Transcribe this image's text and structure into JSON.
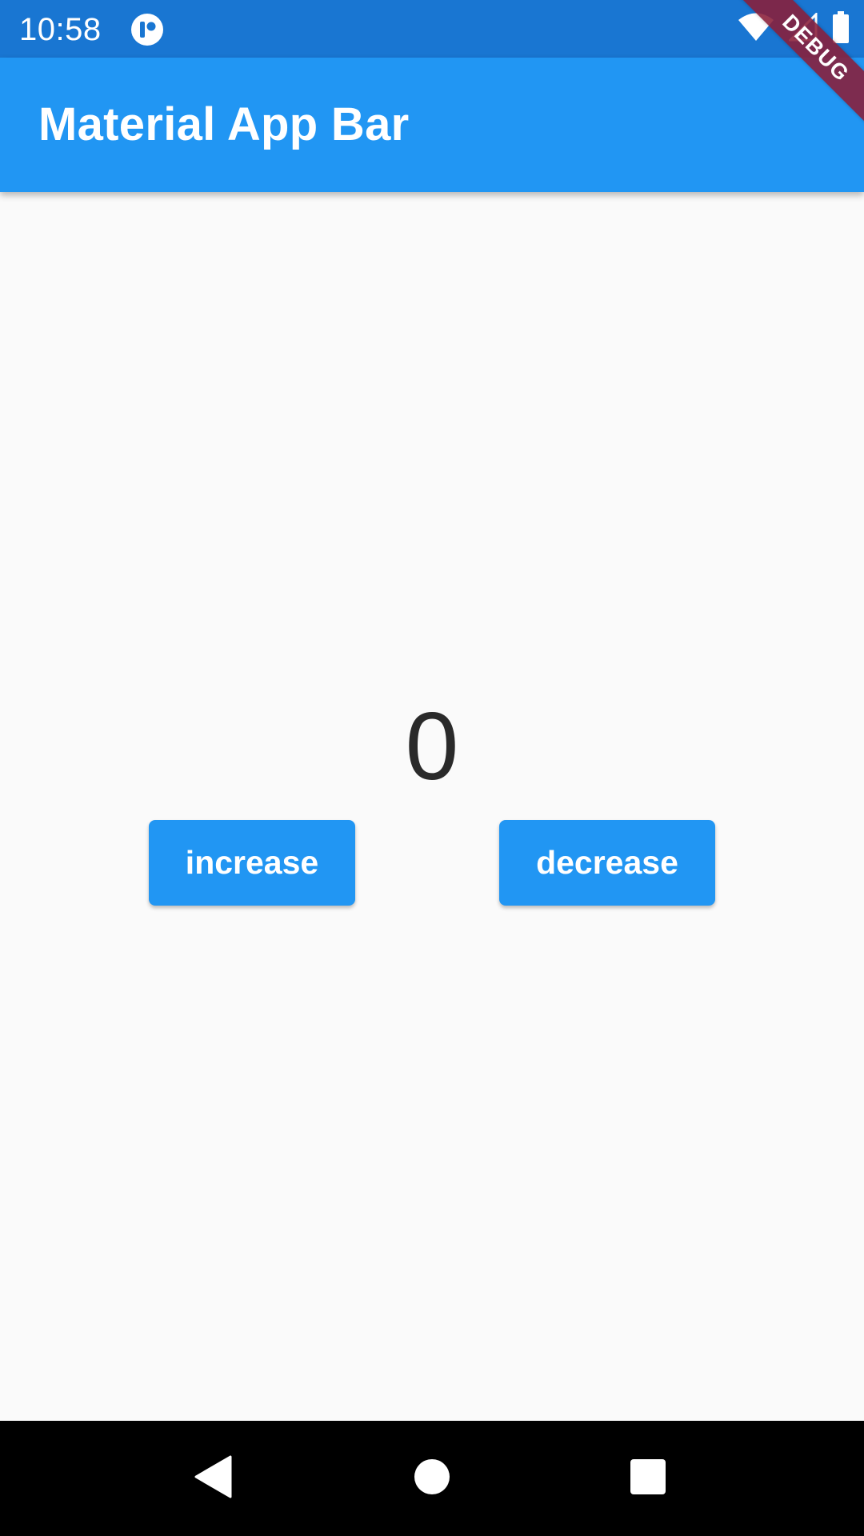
{
  "status_bar": {
    "time": "10:58",
    "app_icon": "notification-app-icon",
    "icons": [
      "wifi-icon",
      "cellular-signal-icon",
      "battery-icon"
    ]
  },
  "app_bar": {
    "title": "Material App Bar",
    "color": "#2196f3"
  },
  "debug_banner": {
    "label": "DEBUG",
    "color": "#8a1e38"
  },
  "counter": {
    "value": "0"
  },
  "buttons": {
    "increase_label": "increase",
    "decrease_label": "decrease"
  },
  "nav_bar": {
    "icons": [
      "back-icon",
      "home-icon",
      "recents-icon"
    ]
  },
  "colors": {
    "status_bar": "#1976d2",
    "background": "#fafafa",
    "accent": "#2196f3"
  }
}
